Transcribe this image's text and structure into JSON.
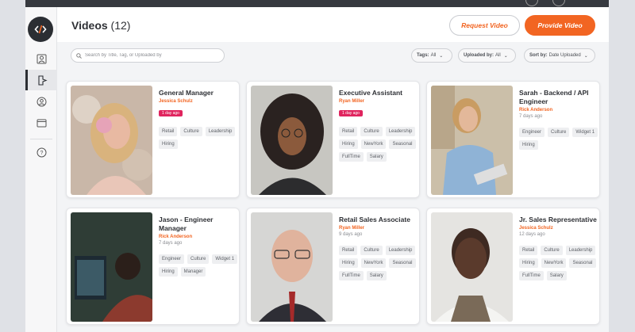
{
  "header": {
    "title": "Videos",
    "count": "(12)",
    "request_label": "Request Video",
    "provide_label": "Provide Video"
  },
  "search": {
    "placeholder": "Search by Title, Tag, or Uploaded by"
  },
  "filters": {
    "tags_label": "Tags:",
    "tags_value": "All",
    "uploaded_label": "Uploaded by:",
    "uploaded_value": "All",
    "sort_label": "Sort by:",
    "sort_value": "Date Uploaded"
  },
  "sidebar": {
    "items": [
      {
        "icon": "user-card-icon"
      },
      {
        "icon": "video-icon"
      },
      {
        "icon": "user-circle-icon"
      },
      {
        "icon": "window-icon"
      },
      {
        "icon": "help-icon"
      }
    ]
  },
  "videos": [
    {
      "title": "General Manager",
      "author": "Jessica Schulz",
      "age": "1 day ago",
      "badge": true,
      "tags": [
        "Retail",
        "Culture",
        "Leadership",
        "Hiring"
      ]
    },
    {
      "title": "Executive Assistant",
      "author": "Ryan Miller",
      "age": "1 day ago",
      "badge": true,
      "tags": [
        "Retail",
        "Culture",
        "Leadership",
        "Hiring",
        "NewYork",
        "Seasonal",
        "FullTime",
        "Salary"
      ]
    },
    {
      "title": "Sarah - Backend / API Engineer",
      "author": "Rick Anderson",
      "age": "7 days ago",
      "badge": false,
      "tags": [
        "Engineer",
        "Culture",
        "Widget 1",
        "Hiring"
      ]
    },
    {
      "title": "Jason - Engineer Manager",
      "author": "Rick Anderson",
      "age": "7 days ago",
      "badge": false,
      "tags": [
        "Engineer",
        "Culture",
        "Widget 1",
        "Hiring",
        "Manager"
      ]
    },
    {
      "title": "Retail Sales Associate",
      "author": "Ryan Miller",
      "age": "9 days ago",
      "badge": false,
      "tags": [
        "Retail",
        "Culture",
        "Leadership",
        "Hiring",
        "NewYork",
        "Seasonal",
        "FullTime",
        "Salary"
      ]
    },
    {
      "title": "Jr. Sales Representative",
      "author": "Jessica Schulz",
      "age": "12 days ago",
      "badge": false,
      "tags": [
        "Retail",
        "Culture",
        "Leadership",
        "Hiring",
        "NewYork",
        "Seasonal",
        "FullTime",
        "Salary"
      ]
    }
  ],
  "colors": {
    "accent": "#f26522",
    "badge": "#e0245e",
    "dark": "#2b2e33"
  }
}
